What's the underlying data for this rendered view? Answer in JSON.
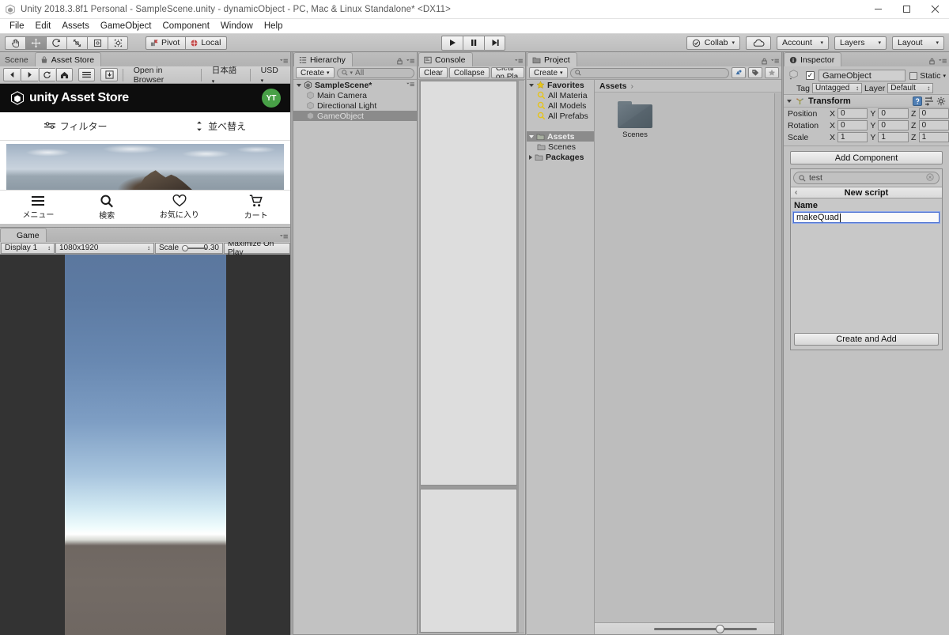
{
  "window": {
    "title": "Unity 2018.3.8f1 Personal - SampleScene.unity - dynamicObject - PC, Mac & Linux Standalone* <DX11>",
    "minimize": "–",
    "maximize": "☐",
    "close": "✕"
  },
  "menubar": {
    "items": [
      "File",
      "Edit",
      "Assets",
      "GameObject",
      "Component",
      "Window",
      "Help"
    ]
  },
  "toolbar": {
    "tools": [
      {
        "name": "hand-tool",
        "active": false
      },
      {
        "name": "move-tool",
        "active": true
      },
      {
        "name": "rotate-tool",
        "active": false
      },
      {
        "name": "scale-tool",
        "active": false
      },
      {
        "name": "rect-tool",
        "active": false
      },
      {
        "name": "transform-tool",
        "active": false
      }
    ],
    "pivot_label": "Pivot",
    "local_label": "Local",
    "play_label": "▶",
    "pause_label": "❙❙",
    "step_label": "▶|",
    "collab_label": "Collab",
    "cloud_icon": "cloud-icon",
    "account_label": "Account",
    "layers_label": "Layers",
    "layout_label": "Layout",
    "caret": "▾"
  },
  "asset_store": {
    "tabs": [
      {
        "label": "Scene",
        "active": false
      },
      {
        "label": "Asset Store",
        "active": true
      }
    ],
    "nav": {
      "back": "◀",
      "forward": "▶",
      "refresh": "⟳",
      "home": "⌂",
      "menu": "≡",
      "download": "⬇",
      "open_in_browser": "Open in Browser",
      "language": "日本語",
      "currency": "USD",
      "caret": "▾"
    },
    "brand": "unity Asset Store",
    "avatar_initials": "YT",
    "filter_label": "フィルター",
    "sort_label": "並べ替え",
    "bottom_nav": [
      {
        "icon": "hamburger-icon",
        "label": "メニュー"
      },
      {
        "icon": "search-icon",
        "label": "検索"
      },
      {
        "icon": "heart-icon",
        "label": "お気に入り"
      },
      {
        "icon": "cart-icon",
        "label": "カート"
      }
    ]
  },
  "game": {
    "tab_label": "Game",
    "display": "Display 1",
    "resolution": "1080x1920",
    "scale_label": "Scale",
    "scale_value": "0.30",
    "maximize_label": "Maximize On Play"
  },
  "hierarchy": {
    "tab_label": "Hierarchy",
    "create_label": "Create",
    "search_placeholder": "All",
    "scene_name": "SampleScene*",
    "items": [
      {
        "label": "Main Camera",
        "selected": false
      },
      {
        "label": "Directional Light",
        "selected": false
      },
      {
        "label": "GameObject",
        "selected": true
      }
    ]
  },
  "console": {
    "tab_label": "Console",
    "clear_label": "Clear",
    "collapse_label": "Collapse",
    "clear_on_play_label": "Clear on Pla"
  },
  "project": {
    "tab_label": "Project",
    "create_label": "Create",
    "search_placeholder": "",
    "breadcrumb": "Assets",
    "breadcrumb_sep": "›",
    "tree": [
      {
        "label": "Favorites",
        "bold": true,
        "indent": 0,
        "arrow": "open",
        "icon": "star-icon",
        "selected": false
      },
      {
        "label": "All Materia",
        "bold": false,
        "indent": 1,
        "arrow": "",
        "icon": "magnifier-icon",
        "selected": false
      },
      {
        "label": "All Models",
        "bold": false,
        "indent": 1,
        "arrow": "",
        "icon": "magnifier-icon",
        "selected": false
      },
      {
        "label": "All Prefabs",
        "bold": false,
        "indent": 1,
        "arrow": "",
        "icon": "magnifier-icon",
        "selected": false
      },
      {
        "label": "",
        "bold": false,
        "indent": 0,
        "arrow": "",
        "icon": "",
        "selected": false
      },
      {
        "label": "Assets",
        "bold": true,
        "indent": 0,
        "arrow": "open",
        "icon": "folder-icon",
        "selected": true
      },
      {
        "label": "Scenes",
        "bold": false,
        "indent": 1,
        "arrow": "",
        "icon": "folder-icon",
        "selected": false
      },
      {
        "label": "Packages",
        "bold": true,
        "indent": 0,
        "arrow": "closed",
        "icon": "folder-icon",
        "selected": false
      }
    ],
    "assets": [
      {
        "name": "Scenes",
        "type": "folder"
      }
    ]
  },
  "inspector": {
    "tab_label": "Inspector",
    "object_name": "GameObject",
    "enabled": true,
    "static_label": "Static",
    "tag_label": "Tag",
    "tag_value": "Untagged",
    "layer_label": "Layer",
    "layer_value": "Default",
    "transform": {
      "title": "Transform",
      "rows": [
        {
          "label": "Position",
          "x": "0",
          "y": "0",
          "z": "0"
        },
        {
          "label": "Rotation",
          "x": "0",
          "y": "0",
          "z": "0"
        },
        {
          "label": "Scale",
          "x": "1",
          "y": "1",
          "z": "1"
        }
      ],
      "axes": [
        "X",
        "Y",
        "Z"
      ]
    },
    "add_component_label": "Add Component",
    "component_search_value": "test",
    "new_script_title": "New script",
    "back_arrow": "‹",
    "name_label": "Name",
    "script_name_value": "makeQuad",
    "create_and_add_label": "Create and Add"
  }
}
